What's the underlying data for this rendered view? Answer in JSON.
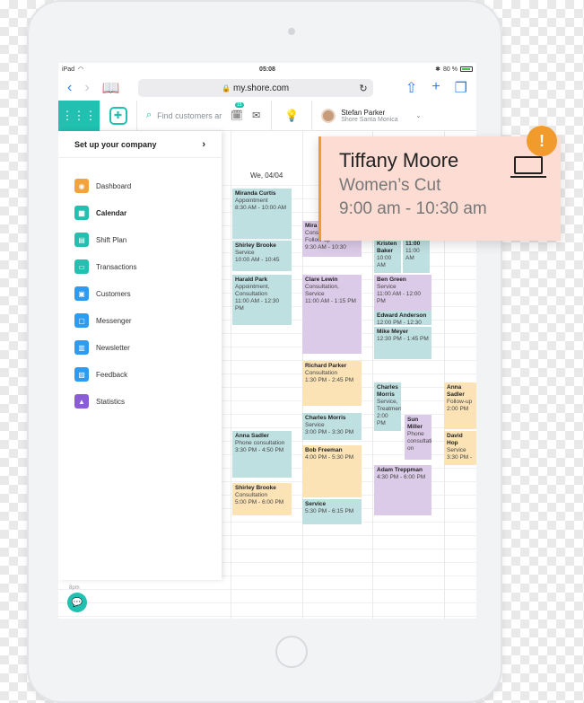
{
  "device": {
    "model": "iPad"
  },
  "statusbar": {
    "carrier": "iPad",
    "time": "05:08",
    "battery": "80 %"
  },
  "browser": {
    "url": "my.shore.com"
  },
  "header": {
    "search_placeholder": "Find customers ar",
    "notification_count": "15",
    "user_name": "Stefan Parker",
    "user_location": "Shore Santa Monica"
  },
  "sidebar": {
    "setup_label": "Set up your company",
    "items": [
      {
        "label": "Dashboard",
        "color": "#f3a33b"
      },
      {
        "label": "Calendar",
        "color": "#21c0b0"
      },
      {
        "label": "Shift Plan",
        "color": "#21c0b0"
      },
      {
        "label": "Transactions",
        "color": "#21c0b0"
      },
      {
        "label": "Customers",
        "color": "#2d9cf0"
      },
      {
        "label": "Messenger",
        "color": "#2d9cf0"
      },
      {
        "label": "Newsletter",
        "color": "#2d9cf0"
      },
      {
        "label": "Feedback",
        "color": "#2d9cf0"
      },
      {
        "label": "Statistics",
        "color": "#8a5cd6"
      }
    ],
    "bottom_time": "8pm"
  },
  "calendar": {
    "day_label": "We, 04/04",
    "appointments": [
      {
        "name": "Miranda Curtis",
        "detail": "Appointment",
        "time": "8:30 AM - 10:00 AM",
        "color": "teal"
      },
      {
        "name": "Shirley Brooke",
        "detail": "Service",
        "time": "10:00 AM - 10:45",
        "color": "teal"
      },
      {
        "name": "Harald Park",
        "detail": "Appointment, Consultation",
        "time": "11:00 AM - 12:30 PM",
        "color": "teal"
      },
      {
        "name": "Mira",
        "detail": "Consultation, Follow-up",
        "time": "9:30 AM - 10:30",
        "color": "purple"
      },
      {
        "name": "Clare Lewin",
        "detail": "Consultation, Service",
        "time": "11:00 AM - 1:15 PM",
        "color": "purple"
      },
      {
        "name": "Kristen Baker",
        "detail": "10:00 AM",
        "time": "",
        "color": "teal"
      },
      {
        "name": "11:00",
        "detail": "11:00 AM",
        "time": "",
        "color": "teal"
      },
      {
        "name": "Ben Green",
        "detail": "Service",
        "time": "11:00 AM - 12:00 PM",
        "color": "purple"
      },
      {
        "name": "Edward Anderson",
        "detail": "12:00 PM - 12:30 PM",
        "time": "",
        "color": "teal"
      },
      {
        "name": "Mike Meyer",
        "detail": "12:30 PM - 1:45 PM",
        "time": "",
        "color": "teal"
      },
      {
        "name": "Richard Parker",
        "detail": "Consultation",
        "time": "1:30 PM - 2:45 PM",
        "color": "yellow"
      },
      {
        "name": "Charles Morris",
        "detail": "Service, Treatmen",
        "time": "2:00 PM",
        "color": "teal"
      },
      {
        "name": "Sun Miller",
        "detail": "Phone consultati on",
        "time": "",
        "color": "purple"
      },
      {
        "name": "Anna Sadler",
        "detail": "Follow-up",
        "time": "2:00 PM",
        "color": "yellow"
      },
      {
        "name": "Charles Morris",
        "detail": "Service",
        "time": "3:00 PM - 3:30 PM",
        "color": "teal"
      },
      {
        "name": "David Hop",
        "detail": "Service",
        "time": "3:30 PM -",
        "color": "yellow"
      },
      {
        "name": "Anna Sadler",
        "detail": "Phone consultation",
        "time": "3:30 PM - 4:50 PM",
        "color": "teal"
      },
      {
        "name": "Bob Freeman",
        "detail": "4:00 PM - 5:30 PM",
        "time": "",
        "color": "yellow"
      },
      {
        "name": "Adam Treppman",
        "detail": "4:30 PM - 6:00 PM",
        "time": "",
        "color": "purple"
      },
      {
        "name": "Shirley Brooke",
        "detail": "Consultation",
        "time": "5:00 PM - 6:00 PM",
        "color": "yellow"
      },
      {
        "name": "Service",
        "detail": "5:30 PM - 6:15 PM",
        "time": "",
        "color": "teal"
      }
    ]
  },
  "popup": {
    "name": "Tiffany Moore",
    "service": "Women’s Cut",
    "time": "9:00 am - 10:30 am",
    "alert_symbol": "!"
  }
}
